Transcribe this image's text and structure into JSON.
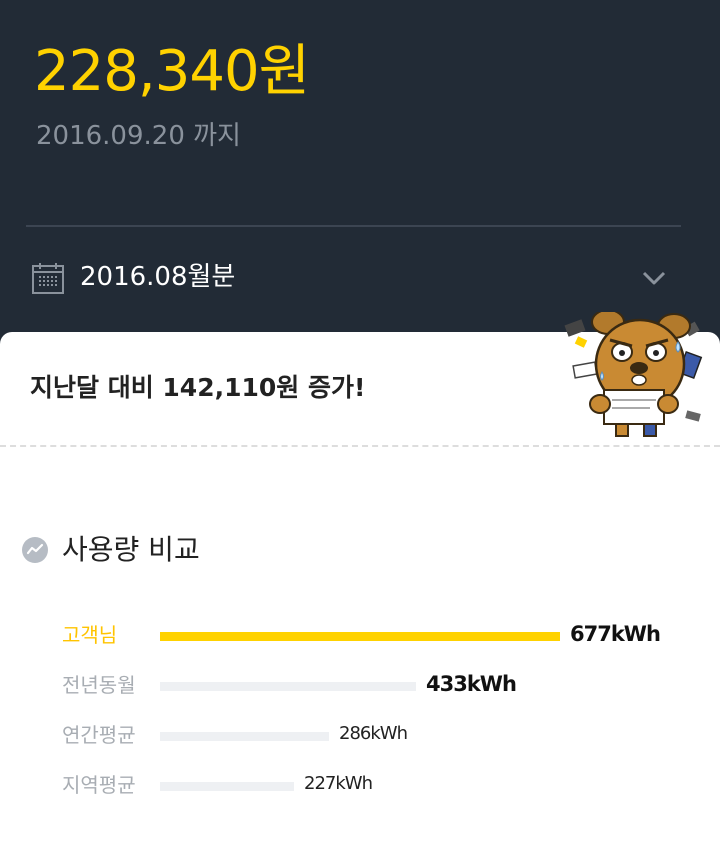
{
  "bill": {
    "amount": "228,340원",
    "due_text": "2016.09.20 까지",
    "period": "2016.08월분"
  },
  "icons": {
    "calendar": "calendar-icon",
    "chevron": "chevron-down-icon",
    "trend": "trend-icon"
  },
  "card": {
    "comparison_message": "지난달 대비 142,110원 증가!",
    "section_title": "사용량 비교"
  },
  "usage": {
    "max_kwh": 677,
    "rows": [
      {
        "label": "고객님",
        "value": 677,
        "value_text": "677kWh"
      },
      {
        "label": "전년동월",
        "value": 433,
        "value_text": "433kWh"
      },
      {
        "label": "연간평균",
        "value": 286,
        "value_text": "286kWh"
      },
      {
        "label": "지역평균",
        "value": 227,
        "value_text": "227kWh"
      }
    ]
  },
  "colors": {
    "header_bg": "#222b36",
    "accent": "#ffd200",
    "bar_bg": "#eef0f3"
  }
}
